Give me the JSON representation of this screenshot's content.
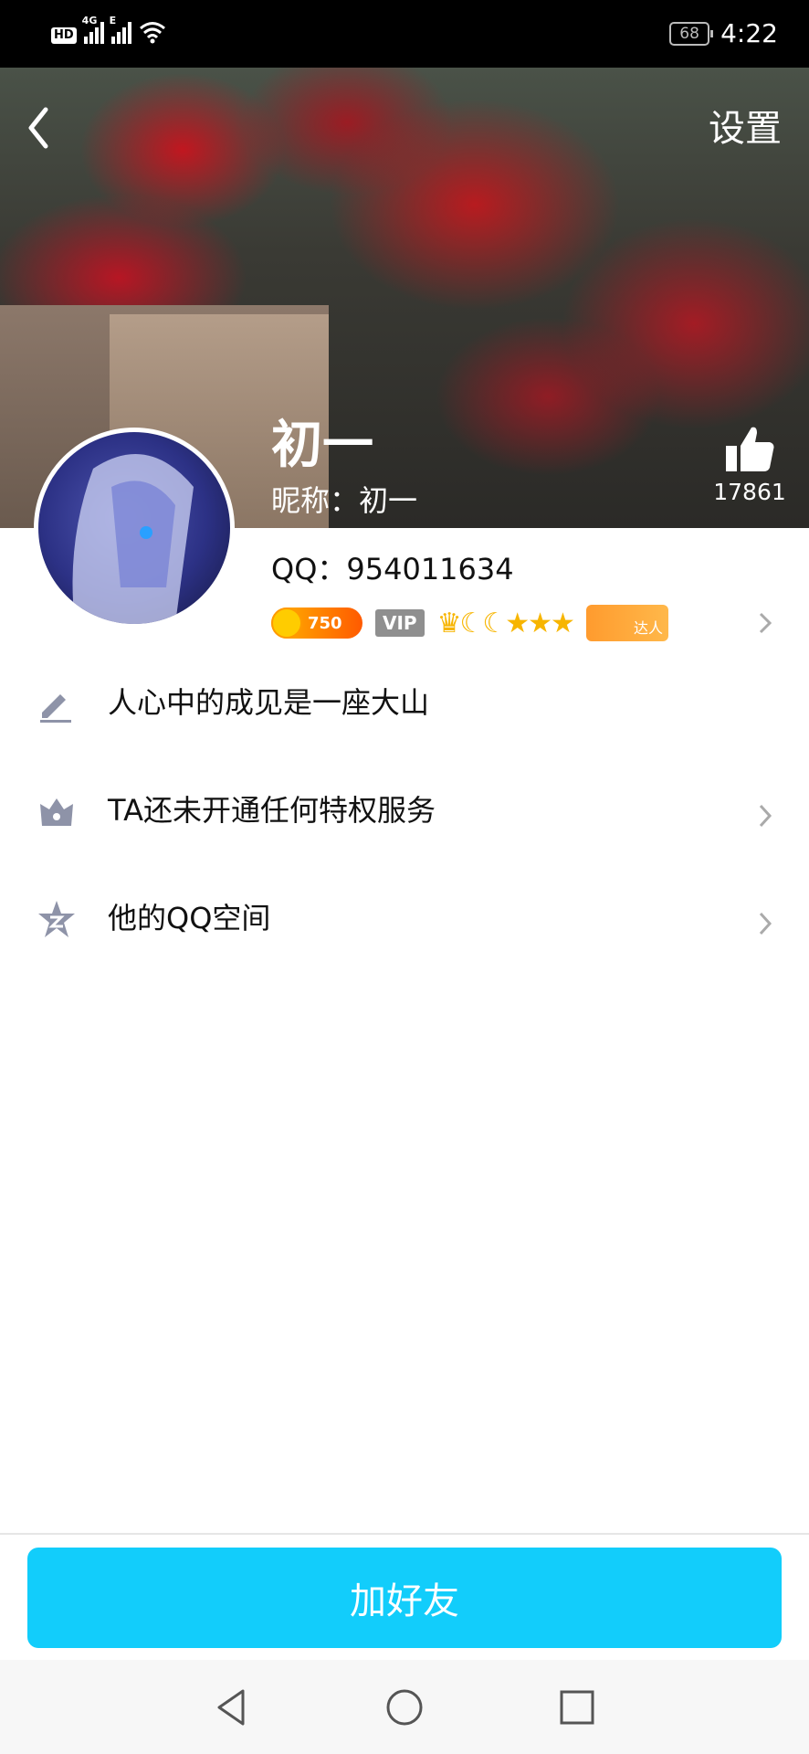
{
  "status_bar": {
    "hd_label": "HD",
    "signal1_label": "4G",
    "signal2_label": "E",
    "battery": "68",
    "time": "4:22"
  },
  "header": {
    "settings_label": "设置",
    "name": "初一",
    "nickname": "昵称：初一",
    "like_count": "17861"
  },
  "profile": {
    "qq_number": "QQ：954011634",
    "badges": {
      "coin_value": "750",
      "vip_label": "VIP",
      "level_icons": "♛☾☾★★★",
      "daren_label": "达人"
    }
  },
  "rows": [
    {
      "icon": "pencil-icon",
      "text": "人心中的成见是一座大山",
      "has_chevron": false
    },
    {
      "icon": "crown-icon",
      "text": "TA还未开通任何特权服务",
      "has_chevron": true
    },
    {
      "icon": "star-icon",
      "text": "他的QQ空间",
      "has_chevron": true
    }
  ],
  "add_friend_label": "加好友",
  "colors": {
    "accent": "#12cdfb",
    "icon_gray": "#8e93a8"
  }
}
